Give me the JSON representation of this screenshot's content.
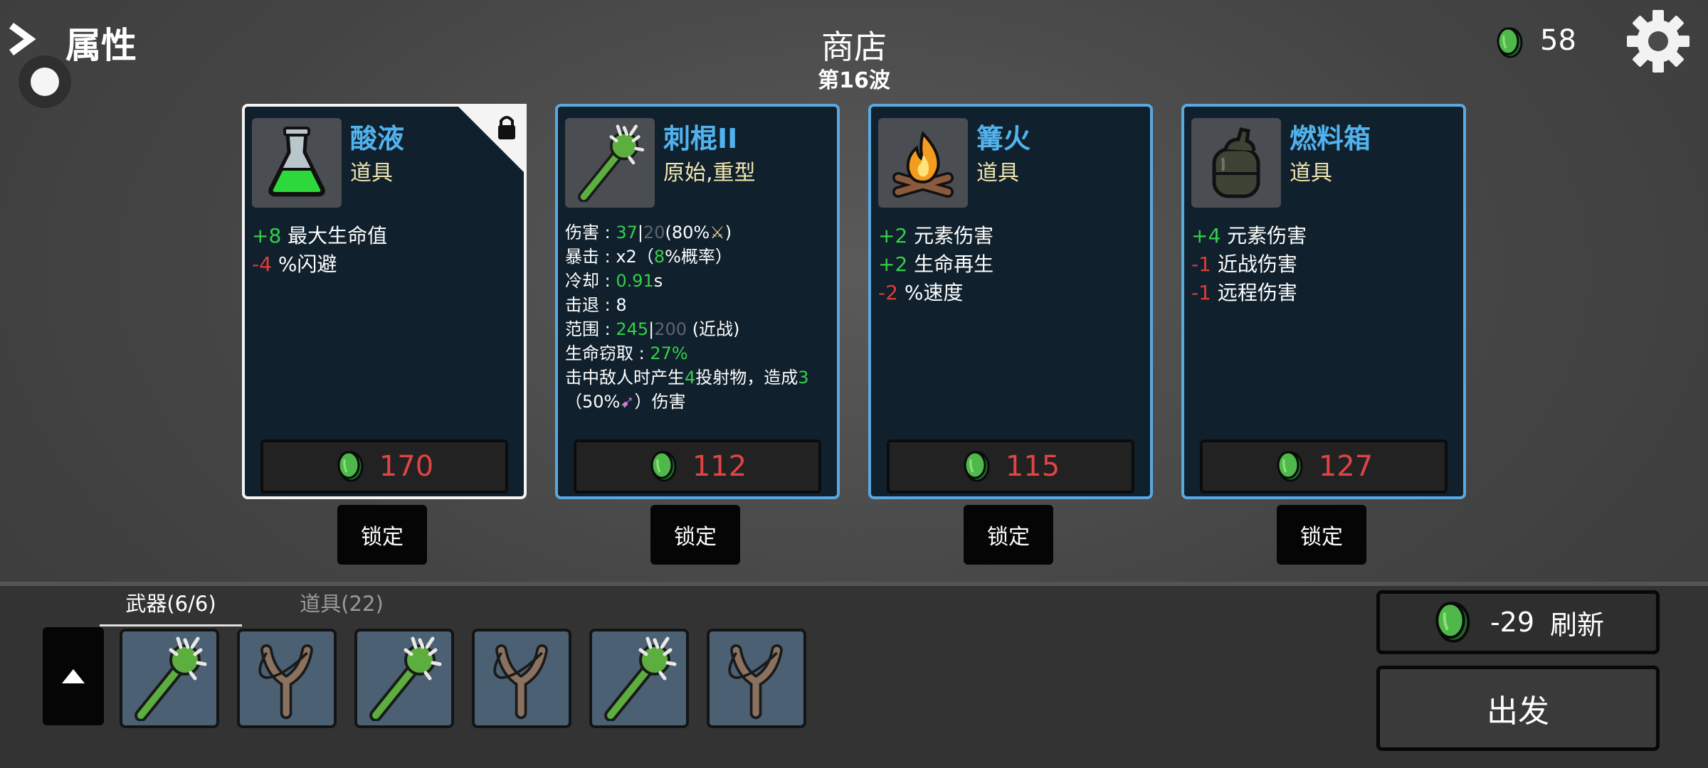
{
  "header": {
    "attributes_label": "属性",
    "shop_title": "商店",
    "wave_label": "第16波",
    "gold_amount": "58",
    "icons": [
      "chevron-right-icon",
      "record-circle-icon",
      "coin-icon",
      "gear-icon"
    ]
  },
  "cards": [
    {
      "name": "酸液",
      "type": "道具",
      "locked": true,
      "icon": "acid-flask-icon",
      "stats": [
        {
          "value": "+8",
          "text": " 最大生命值"
        },
        {
          "value": "-4",
          "text": " %闪避"
        }
      ],
      "price": "170",
      "lock_label": "锁定"
    },
    {
      "name": "刺棍II",
      "type": "原始,重型",
      "locked": false,
      "icon": "spiked-club-icon",
      "weapon_stats": {
        "damage_label": "伤害 : ",
        "damage_value": "37",
        "damage_base": "20",
        "damage_scaling": "(80%",
        "crit_label": "暴击 : ",
        "crit_mult": " x2（",
        "crit_chance": "8",
        "crit_suffix": "%概率）",
        "cooldown_label": "冷却 : ",
        "cooldown_value": "0.91",
        "cooldown_unit": "s",
        "knockback_label": "击退 : ",
        "knockback_value": "8",
        "range_label": "范围 : ",
        "range_value": "245",
        "range_base": "200",
        "range_type": " (近战)",
        "lifesteal_label": "生命窃取 : ",
        "lifesteal_value": "27%",
        "effect_prefix": "击中敌人时产生",
        "effect_count": "4",
        "effect_mid": "投射物，造成",
        "effect_damage": "3",
        "effect_scaling": "（50%",
        "effect_suffix": "）伤害"
      },
      "price": "112",
      "lock_label": "锁定"
    },
    {
      "name": "篝火",
      "type": "道具",
      "locked": false,
      "icon": "campfire-icon",
      "stats": [
        {
          "value": "+2",
          "text": " 元素伤害"
        },
        {
          "value": "+2",
          "text": " 生命再生"
        },
        {
          "value": "-2",
          "text": " %速度"
        }
      ],
      "price": "115",
      "lock_label": "锁定"
    },
    {
      "name": "燃料箱",
      "type": "道具",
      "locked": false,
      "icon": "fuel-tank-icon",
      "stats": [
        {
          "value": "+4",
          "text": " 元素伤害"
        },
        {
          "value": "-1",
          "text": " 近战伤害"
        },
        {
          "value": "-1",
          "text": " 远程伤害"
        }
      ],
      "price": "127",
      "lock_label": "锁定"
    }
  ],
  "inventory": {
    "tab_weapons": "武器(6/6)",
    "tab_items": "道具(22)",
    "slots": [
      "spiked-club-icon",
      "slingshot-icon",
      "spiked-club-icon",
      "slingshot-icon",
      "spiked-club-icon",
      "slingshot-icon"
    ]
  },
  "actions": {
    "refresh_cost": "-29",
    "refresh_label": "刷新",
    "go_label": "出发"
  },
  "colors": {
    "positive": "#34d04a",
    "negative": "#e23a3a",
    "card_border": "#5aa8e0",
    "locked_border": "#f4f4f4",
    "item_name": "#52b2ee",
    "price": "#e04444"
  }
}
